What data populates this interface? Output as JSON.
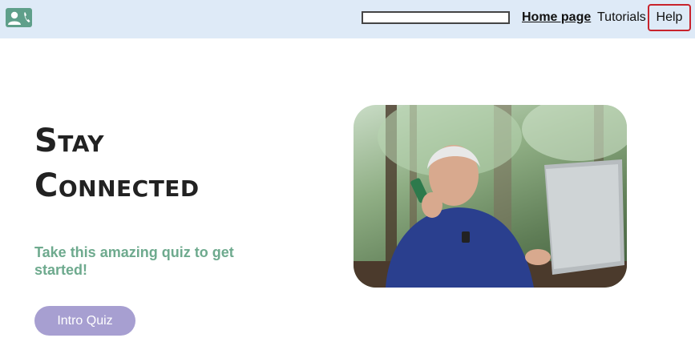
{
  "navbar": {
    "logo_icon": "contact-phone-icon",
    "search_value": "",
    "links": {
      "home": "Home page",
      "tutorials": "Tutorials",
      "help": "Help"
    }
  },
  "hero": {
    "title_line1": "Stay",
    "title_line2": "Connected",
    "subtitle": "Take this amazing quiz to get started!",
    "cta_label": "Intro Quiz",
    "image_icon": "senior-man-on-phone-with-laptop-photo"
  },
  "colors": {
    "navbar_bg": "#deeaf7",
    "accent_green": "#6eaa8e",
    "button_purple": "#a79fd1",
    "focus_red": "#c8232c"
  }
}
